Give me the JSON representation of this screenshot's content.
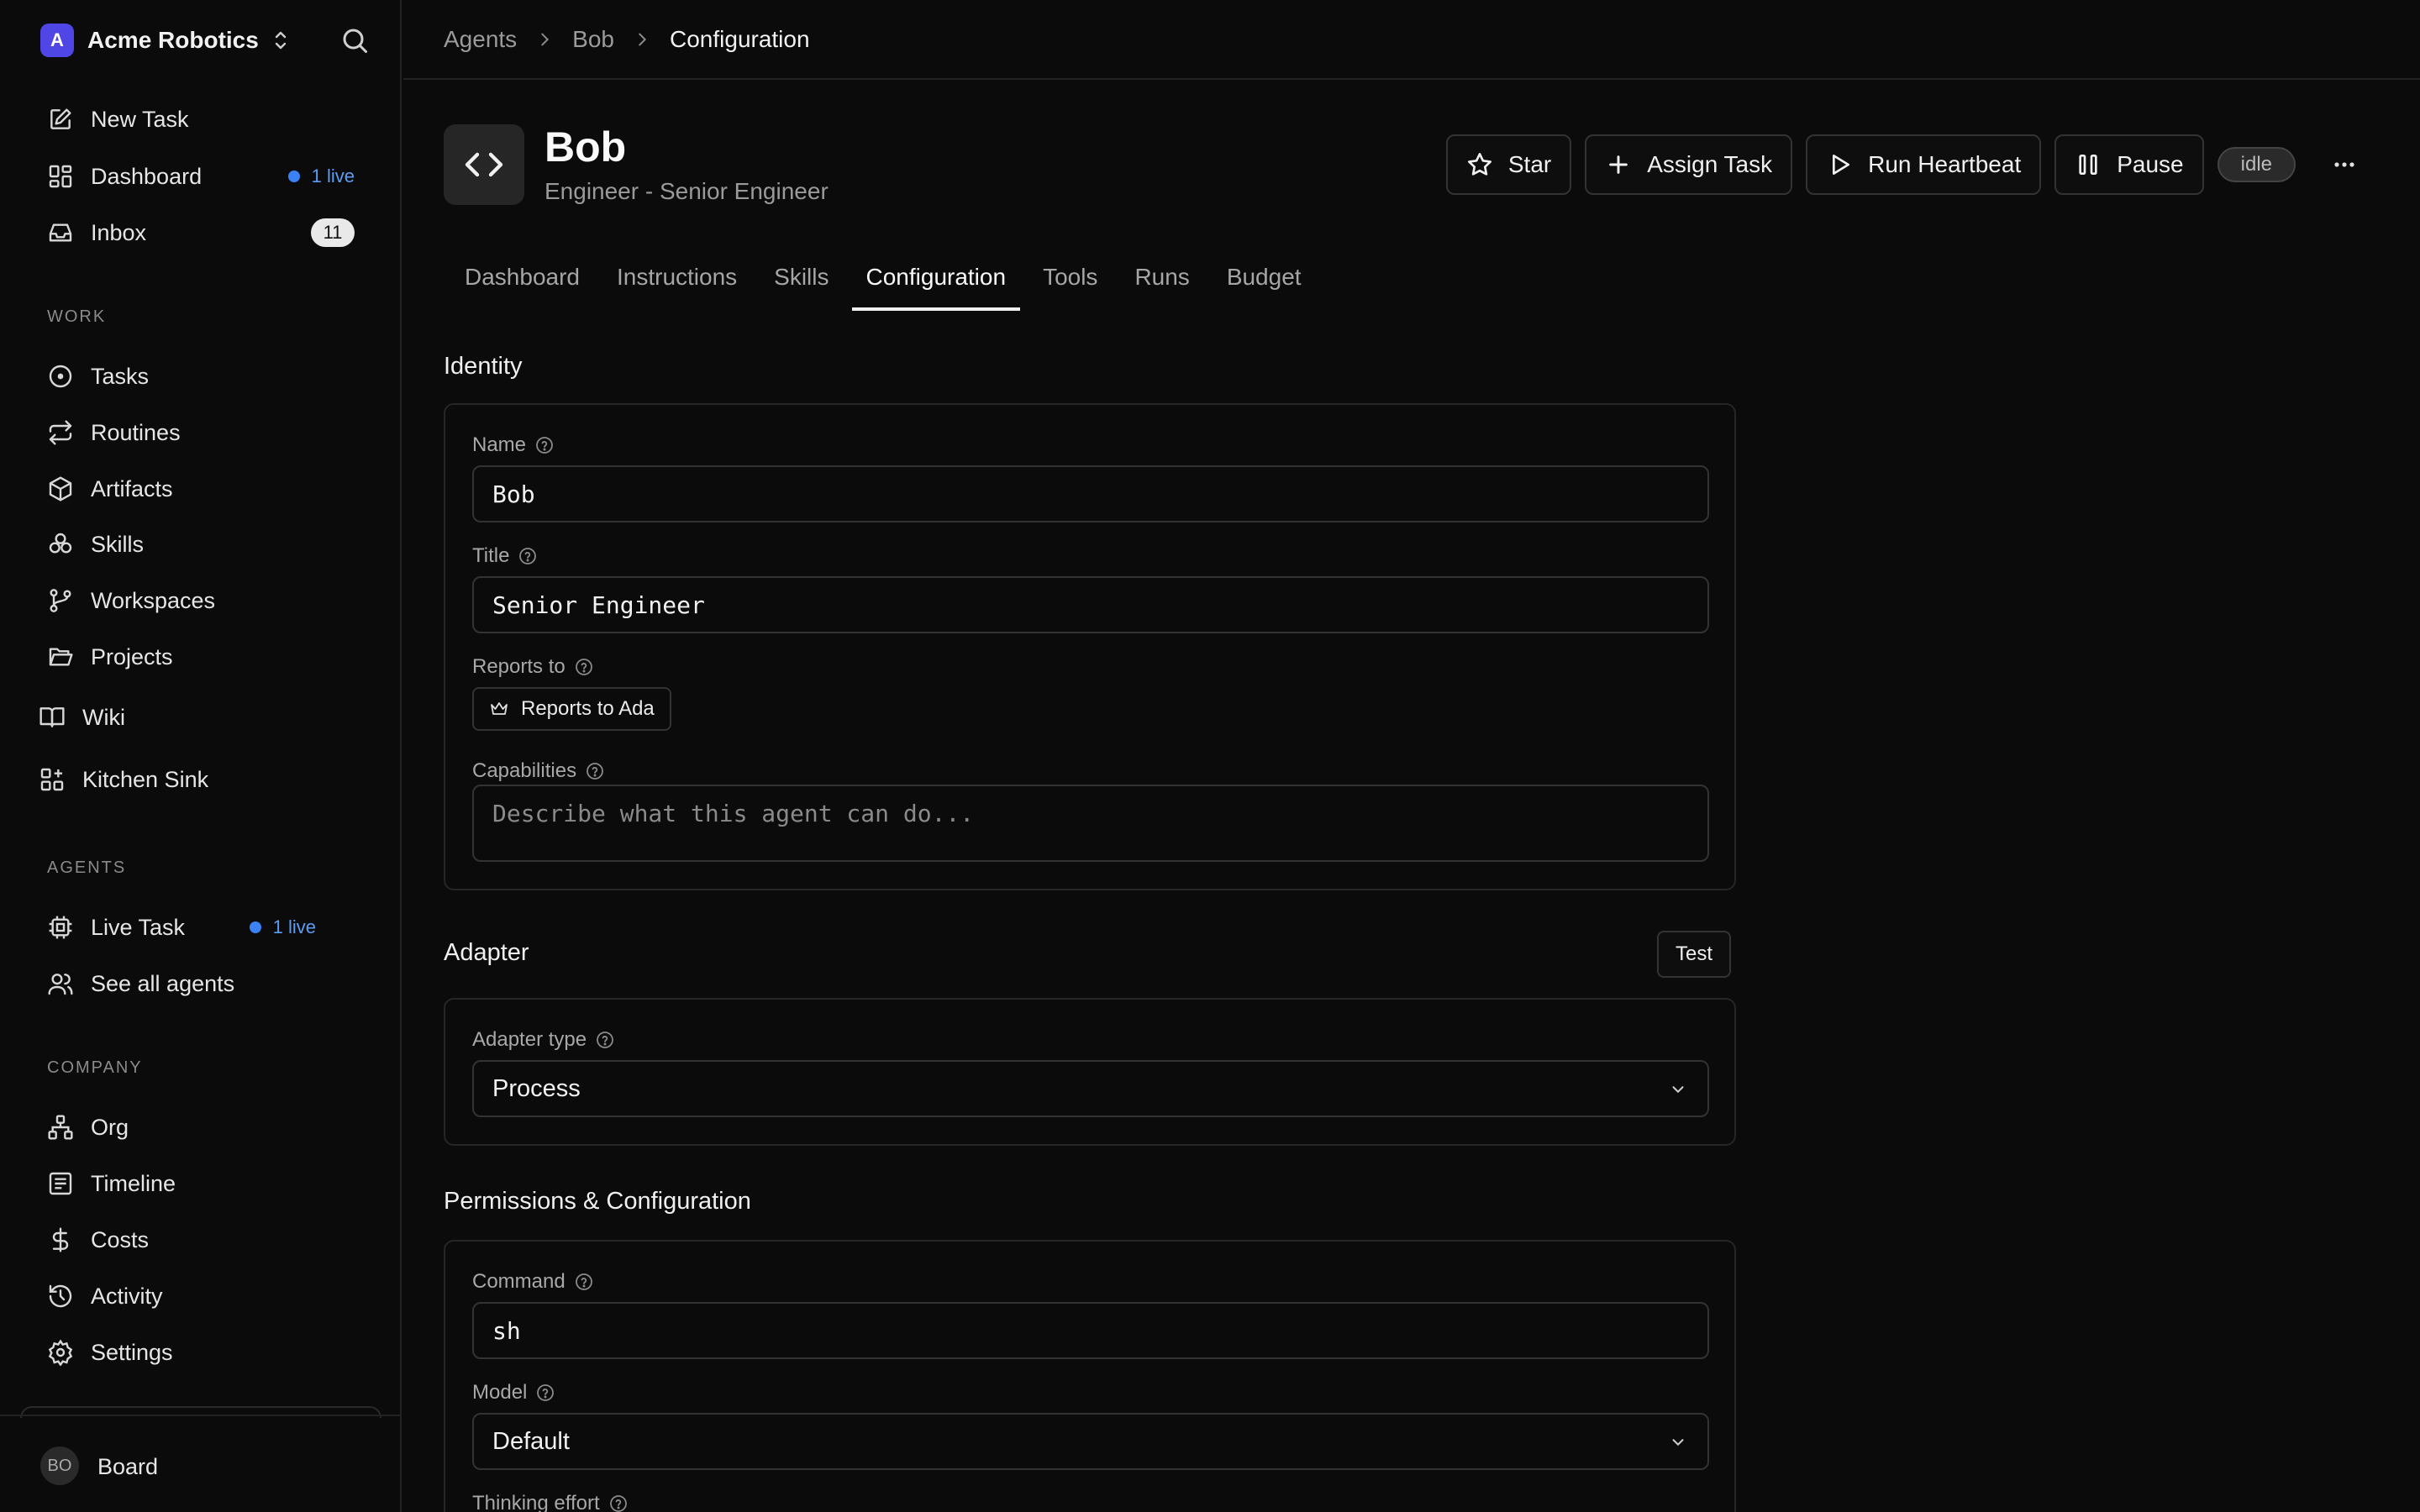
{
  "workspace": {
    "logo_letter": "A",
    "name": "Acme Robotics"
  },
  "nav_primary": [
    {
      "label": "New Task",
      "icon": "pencil-square-icon"
    },
    {
      "label": "Dashboard",
      "icon": "dashboard-icon",
      "live": "1 live"
    },
    {
      "label": "Inbox",
      "icon": "inbox-icon",
      "count": "11"
    }
  ],
  "sections": {
    "work": "WORK",
    "agents": "AGENTS",
    "company": "COMPANY"
  },
  "nav_work": [
    "Tasks",
    "Routines",
    "Artifacts",
    "Skills",
    "Workspaces",
    "Projects",
    "Wiki",
    "Kitchen Sink"
  ],
  "nav_agents": [
    {
      "label": "Live Task",
      "live": "1 live"
    },
    {
      "label": "See all agents"
    }
  ],
  "nav_company": [
    "Org",
    "Timeline",
    "Costs",
    "Activity",
    "Settings"
  ],
  "user": {
    "initials": "BO",
    "name": "Board"
  },
  "breadcrumb": [
    "Agents",
    "Bob",
    "Configuration"
  ],
  "agent": {
    "name": "Bob",
    "subtitle": "Engineer - Senior Engineer",
    "status": "idle"
  },
  "actions": {
    "star": "Star",
    "assign": "Assign Task",
    "heartbeat": "Run Heartbeat",
    "pause": "Pause"
  },
  "tabs": [
    "Dashboard",
    "Instructions",
    "Skills",
    "Configuration",
    "Tools",
    "Runs",
    "Budget"
  ],
  "active_tab": "Configuration",
  "identity": {
    "title": "Identity",
    "name_label": "Name",
    "name_value": "Bob",
    "title_label": "Title",
    "title_value": "Senior Engineer",
    "reports_label": "Reports to",
    "reports_value": "Reports to Ada",
    "capabilities_label": "Capabilities",
    "capabilities_placeholder": "Describe what this agent can do..."
  },
  "adapter": {
    "title": "Adapter",
    "test_label": "Test",
    "type_label": "Adapter type",
    "type_value": "Process"
  },
  "permissions": {
    "title": "Permissions & Configuration",
    "command_label": "Command",
    "command_value": "sh",
    "model_label": "Model",
    "model_value": "Default",
    "thinking_label": "Thinking effort"
  }
}
